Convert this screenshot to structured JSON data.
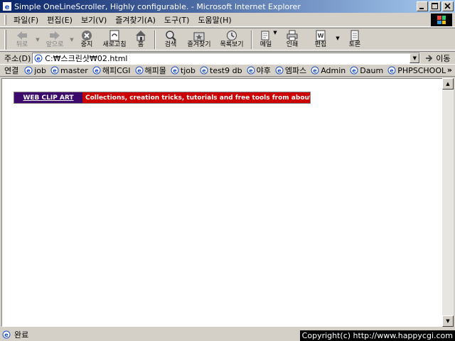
{
  "window": {
    "title": "Simple OneLineScroller, Highly configurable. - Microsoft Internet Explorer"
  },
  "menu": [
    "파일(F)",
    "편집(E)",
    "보기(V)",
    "즐겨찾기(A)",
    "도구(T)",
    "도움말(H)"
  ],
  "toolbar": {
    "back": "뒤로",
    "forward": "앞으로",
    "stop": "중지",
    "refresh": "새로고침",
    "home": "홈",
    "search": "검색",
    "favorites": "즐겨찾기",
    "history": "목록보기",
    "mail": "메일",
    "print": "인쇄",
    "edit": "편집",
    "discuss": "토론"
  },
  "address": {
    "label": "주소(D)",
    "value": "C:₩스크린샷₩02.html",
    "go": "이동"
  },
  "links": {
    "label": "연결",
    "items": [
      "job",
      "master",
      "해피CGI",
      "해피몰",
      "tjob",
      "test9 db",
      "야후",
      "엠파스",
      "Admin",
      "Daum",
      "PHPSCHOOL"
    ],
    "more": "»"
  },
  "banner": {
    "left": "WEB CLIP ART",
    "right": "Collections, creation tricks, tutorials and free tools from about.com"
  },
  "status": {
    "text": "완료",
    "copyright": "Copyright(c) http://www.happycgi.com"
  },
  "colors": {
    "titlebar_start": "#0a246a",
    "banner_left": "#3b0a6b",
    "banner_right": "#cc0000"
  }
}
